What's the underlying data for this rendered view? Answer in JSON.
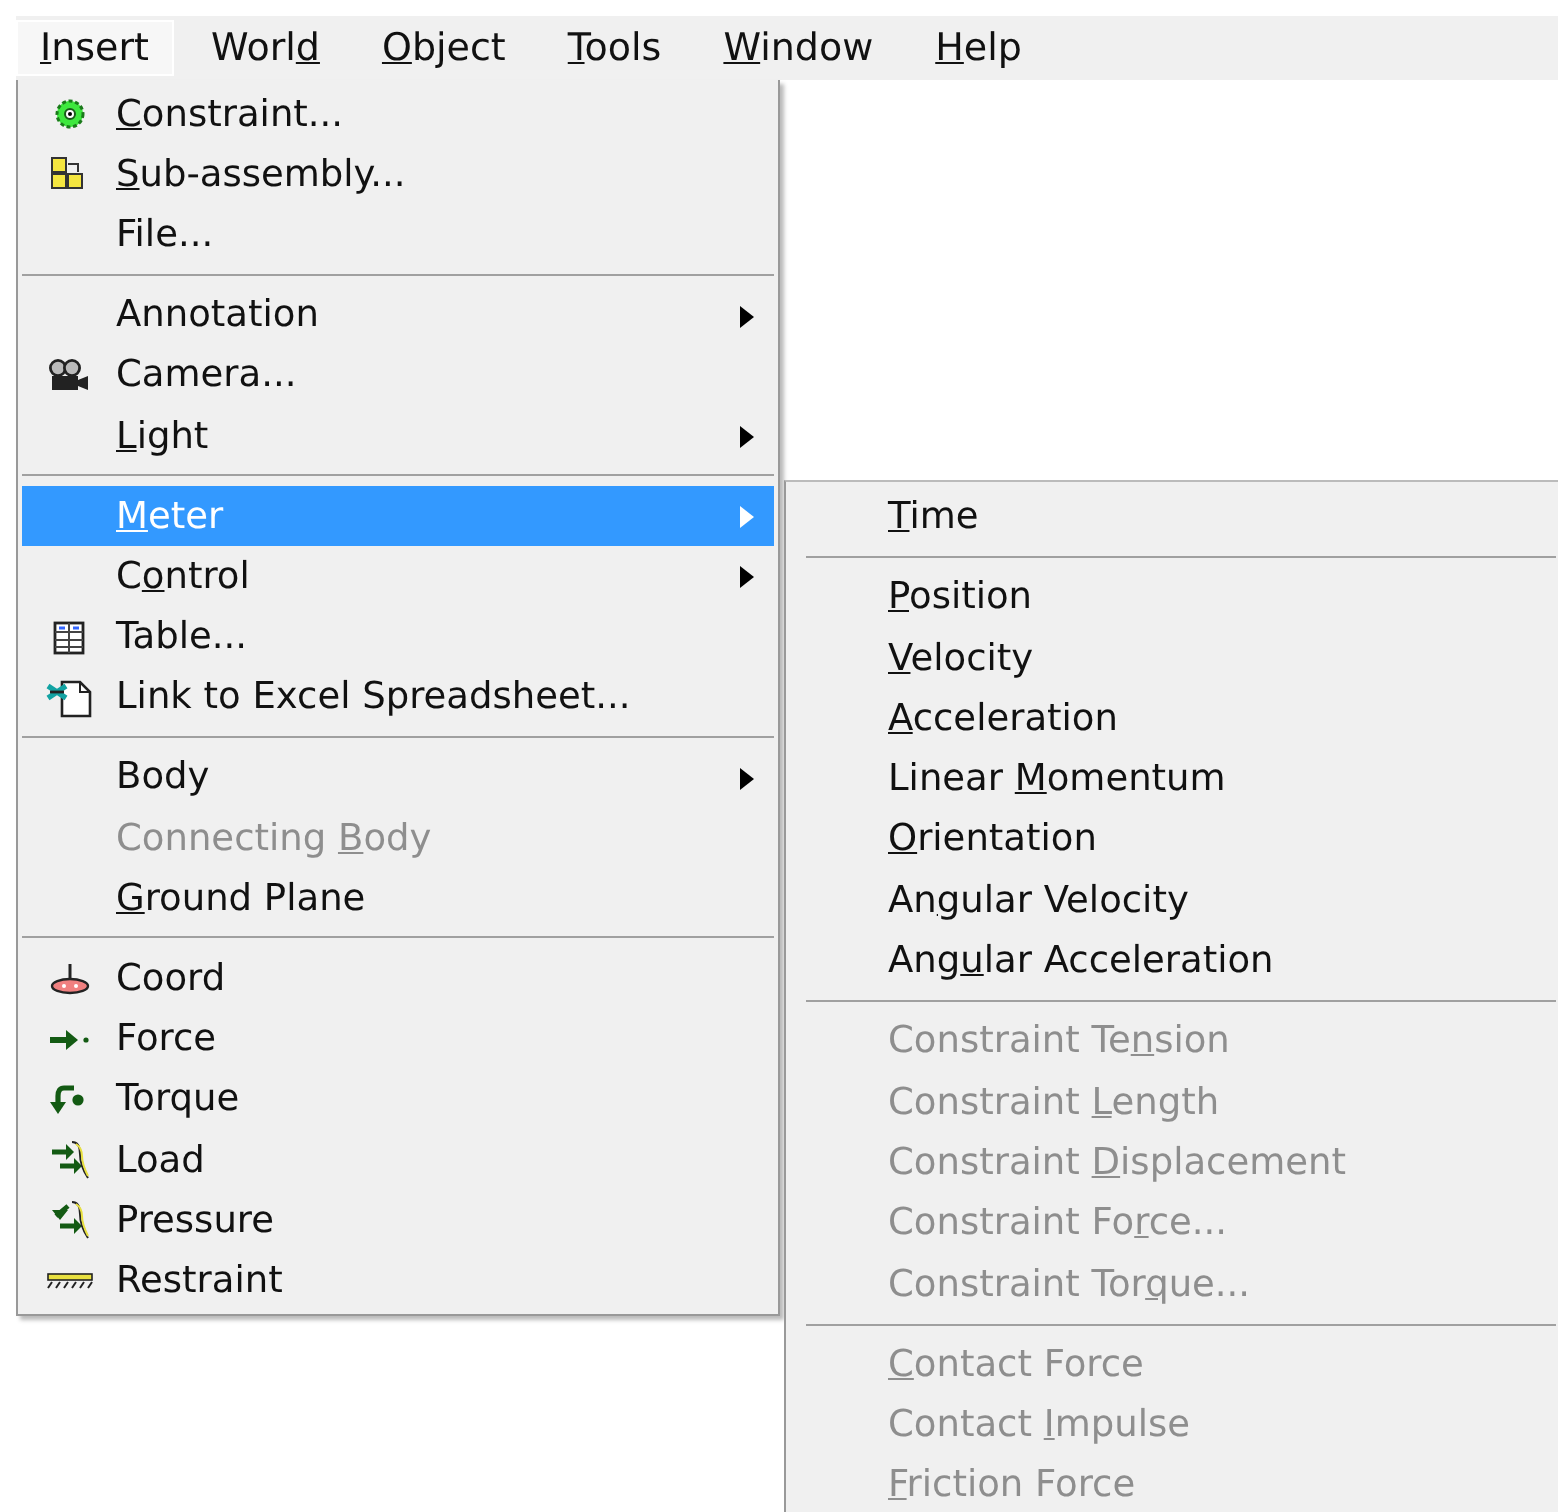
{
  "menubar": [
    {
      "label": {
        "key": "I",
        "post": "nsert"
      },
      "selected": true
    },
    {
      "label": {
        "pre": "Worl",
        "key": "d"
      },
      "selected": false
    },
    {
      "label": {
        "key": "O",
        "post": "bject"
      },
      "selected": false
    },
    {
      "label": {
        "key": "T",
        "post": "ools"
      },
      "selected": false
    },
    {
      "label": {
        "key": "W",
        "post": "indow"
      },
      "selected": false
    },
    {
      "label": {
        "key": "H",
        "post": "elp"
      },
      "selected": false
    }
  ],
  "menu": [
    [
      {
        "label": {
          "key": "C",
          "post": "onstraint..."
        },
        "kind": "constraint",
        "submenu": false,
        "disabled": false,
        "selected": false
      },
      {
        "label": {
          "key": "S",
          "post": "ub-assembly..."
        },
        "kind": "subassembly",
        "submenu": false,
        "disabled": false,
        "selected": false
      },
      {
        "label": {
          "pre": "File..."
        },
        "kind": "plain",
        "submenu": false,
        "disabled": false,
        "selected": false
      }
    ],
    [
      {
        "label": {
          "pre": "Annotation"
        },
        "kind": "plain",
        "submenu": true,
        "disabled": false,
        "selected": false
      },
      {
        "label": {
          "pre": "Camera..."
        },
        "kind": "camera",
        "submenu": false,
        "disabled": false,
        "selected": false
      },
      {
        "label": {
          "key": "L",
          "post": "ight"
        },
        "kind": "plain",
        "submenu": true,
        "disabled": false,
        "selected": false
      }
    ],
    [
      {
        "label": {
          "key": "M",
          "post": "eter"
        },
        "kind": "plain",
        "submenu": true,
        "disabled": false,
        "selected": true
      },
      {
        "label": {
          "pre": "C",
          "key": "o",
          "post": "ntrol"
        },
        "kind": "plain",
        "submenu": true,
        "disabled": false,
        "selected": false
      },
      {
        "label": {
          "pre": "Table..."
        },
        "kind": "table",
        "submenu": false,
        "disabled": false,
        "selected": false
      },
      {
        "label": {
          "pre": "Link to Excel Spreadsheet..."
        },
        "kind": "excel",
        "submenu": false,
        "disabled": false,
        "selected": false
      }
    ],
    [
      {
        "label": {
          "pre": "Body"
        },
        "kind": "plain",
        "submenu": true,
        "disabled": false,
        "selected": false
      },
      {
        "label": {
          "pre": "Connecting ",
          "key": "B",
          "post": "ody"
        },
        "kind": "plain",
        "submenu": false,
        "disabled": true,
        "selected": false
      },
      {
        "label": {
          "key": "G",
          "post": "round Plane"
        },
        "kind": "plain",
        "submenu": false,
        "disabled": false,
        "selected": false
      }
    ],
    [
      {
        "label": {
          "pre": "Coord"
        },
        "kind": "coord",
        "submenu": false,
        "disabled": false,
        "selected": false
      },
      {
        "label": {
          "pre": "Force"
        },
        "kind": "force",
        "submenu": false,
        "disabled": false,
        "selected": false
      },
      {
        "label": {
          "pre": "Torque"
        },
        "kind": "torque",
        "submenu": false,
        "disabled": false,
        "selected": false
      },
      {
        "label": {
          "pre": "Load"
        },
        "kind": "load",
        "submenu": false,
        "disabled": false,
        "selected": false
      },
      {
        "label": {
          "pre": "Pressure"
        },
        "kind": "pressure",
        "submenu": false,
        "disabled": false,
        "selected": false
      },
      {
        "label": {
          "pre": "Restraint"
        },
        "kind": "restraint",
        "submenu": false,
        "disabled": false,
        "selected": false
      }
    ]
  ],
  "submenu": [
    [
      {
        "label": {
          "key": "T",
          "post": "ime"
        },
        "disabled": false
      }
    ],
    [
      {
        "label": {
          "key": "P",
          "post": "osition"
        },
        "disabled": false
      },
      {
        "label": {
          "key": "V",
          "post": "elocity"
        },
        "disabled": false
      },
      {
        "label": {
          "key": "A",
          "post": "cceleration"
        },
        "disabled": false
      },
      {
        "label": {
          "pre": "Linear ",
          "key": "M",
          "post": "omentum"
        },
        "disabled": false
      },
      {
        "label": {
          "key": "O",
          "post": "rientation"
        },
        "disabled": false
      },
      {
        "label": {
          "pre": "An",
          "key": "g",
          "post": "ular Velocity"
        },
        "disabled": false
      },
      {
        "label": {
          "pre": "Ang",
          "key": "u",
          "post": "lar Acceleration"
        },
        "disabled": false
      }
    ],
    [
      {
        "label": {
          "pre": "Constraint Te",
          "key": "n",
          "post": "sion"
        },
        "disabled": true
      },
      {
        "label": {
          "pre": "Constraint ",
          "key": "L",
          "post": "ength"
        },
        "disabled": true
      },
      {
        "label": {
          "pre": "Constraint ",
          "key": "D",
          "post": "isplacement"
        },
        "disabled": true
      },
      {
        "label": {
          "pre": "Constraint Fo",
          "key": "r",
          "post": "ce..."
        },
        "disabled": true
      },
      {
        "label": {
          "pre": "Constraint Tor",
          "key": "q",
          "post": "ue..."
        },
        "disabled": true
      }
    ],
    [
      {
        "label": {
          "key": "C",
          "post": "ontact Force"
        },
        "disabled": true
      },
      {
        "label": {
          "pre": "Contact ",
          "key": "I",
          "post": "mpulse"
        },
        "disabled": true
      },
      {
        "label": {
          "key": "F",
          "post": "riction Force"
        },
        "disabled": true
      }
    ]
  ]
}
